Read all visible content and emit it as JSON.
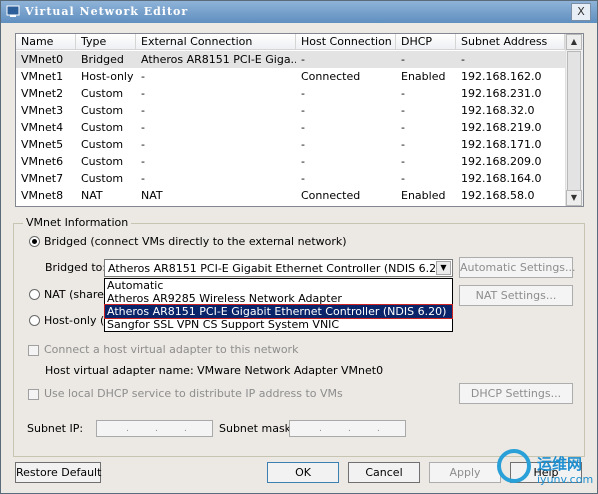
{
  "window": {
    "title": "Virtual Network Editor",
    "close_label": "X"
  },
  "table": {
    "columns": [
      "Name",
      "Type",
      "External Connection",
      "Host Connection",
      "DHCP",
      "Subnet Address"
    ],
    "rows": [
      [
        "VMnet0",
        "Bridged",
        "Atheros AR8151 PCI-E Giga...",
        "-",
        "-",
        "-"
      ],
      [
        "VMnet1",
        "Host-only",
        "-",
        "Connected",
        "Enabled",
        "192.168.162.0"
      ],
      [
        "VMnet2",
        "Custom",
        "-",
        "-",
        "-",
        "192.168.231.0"
      ],
      [
        "VMnet3",
        "Custom",
        "-",
        "-",
        "-",
        "192.168.32.0"
      ],
      [
        "VMnet4",
        "Custom",
        "-",
        "-",
        "-",
        "192.168.219.0"
      ],
      [
        "VMnet5",
        "Custom",
        "-",
        "-",
        "-",
        "192.168.171.0"
      ],
      [
        "VMnet6",
        "Custom",
        "-",
        "-",
        "-",
        "192.168.209.0"
      ],
      [
        "VMnet7",
        "Custom",
        "-",
        "-",
        "-",
        "192.168.164.0"
      ],
      [
        "VMnet8",
        "NAT",
        "NAT",
        "Connected",
        "Enabled",
        "192.168.58.0"
      ]
    ],
    "selected_row": 0
  },
  "vmnet_info": {
    "title": "VMnet Information",
    "bridged_label": "Bridged (connect VMs directly to the external network)",
    "nat_label": "NAT (shared",
    "hostonly_label": "Host-only (c",
    "bridged_to_label": "Bridged to:",
    "bridged_to_value": "Atheros AR8151 PCI-E Gigabit Ethernet Controller (NDIS 6.20)",
    "dropdown_options": [
      "Automatic",
      "Atheros AR9285 Wireless Network Adapter",
      "Atheros AR8151 PCI-E Gigabit Ethernet Controller (NDIS 6.20)",
      "Sangfor SSL VPN CS Support System VNIC"
    ],
    "highlighted_option": 2,
    "automatic_settings": "Automatic Settings...",
    "nat_settings": "NAT Settings...",
    "connect_host_adapter": "Connect a host virtual adapter to this network",
    "host_adapter_name": "Host virtual adapter name: VMware Network Adapter VMnet0",
    "use_dhcp": "Use local DHCP service to distribute IP address to VMs",
    "dhcp_settings": "DHCP Settings...",
    "subnet_ip_label": "Subnet IP:",
    "subnet_mask_label": "Subnet mask:",
    "ip_dot": "."
  },
  "footer": {
    "restore_default": "Restore Default",
    "ok": "OK",
    "cancel": "Cancel",
    "apply": "Apply",
    "help": "Help"
  },
  "watermark": {
    "cn": "运维网",
    "en": "iyunv.com"
  },
  "colors": {
    "selection": "#0a246a",
    "highlight_outline": "#cc2222",
    "title_gradient_top": "#8fb3d8",
    "title_gradient_bottom": "#5f8fc0"
  }
}
